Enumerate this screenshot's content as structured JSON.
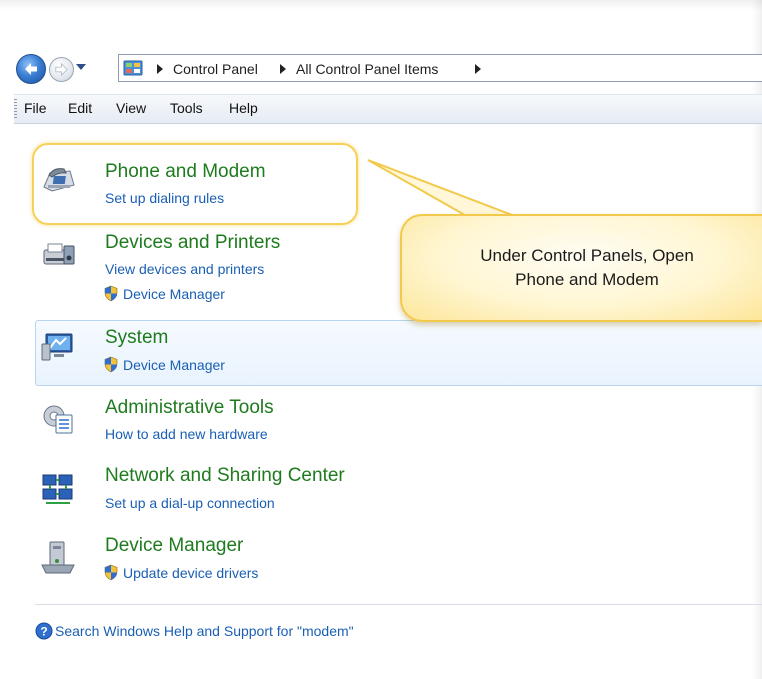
{
  "breadcrumb": {
    "items": [
      "Control Panel",
      "All Control Panel Items"
    ]
  },
  "menu": {
    "items": [
      "File",
      "Edit",
      "View",
      "Tools",
      "Help"
    ]
  },
  "items": [
    {
      "title": "Phone and Modem",
      "links": [
        "Set up dialing rules"
      ]
    },
    {
      "title": "Devices and Printers",
      "links": [
        "View devices and printers"
      ],
      "shield_links": [
        "Device Manager"
      ]
    },
    {
      "title": "System",
      "shield_links": [
        "Device Manager"
      ]
    },
    {
      "title": "Administrative Tools",
      "links": [
        "How to add new hardware"
      ]
    },
    {
      "title": "Network and Sharing Center",
      "links": [
        "Set up a dial-up connection"
      ]
    },
    {
      "title": "Device Manager",
      "shield_links": [
        "Update device drivers"
      ]
    }
  ],
  "callout": {
    "line1": "Under Control Panels, Open",
    "line2": "Phone and Modem"
  },
  "help": {
    "label": "Search Windows Help and Support for \"modem\""
  },
  "colors": {
    "title_green": "#1e7b1e",
    "link_blue": "#1a5fb4",
    "callout_gold": "#f2c94c"
  },
  "icons": [
    "back-arrow-icon",
    "forward-arrow-icon",
    "control-panel-icon",
    "phone-modem-icon",
    "printer-icon",
    "system-monitor-icon",
    "admin-tools-icon",
    "network-icon",
    "device-manager-icon",
    "uac-shield-icon",
    "help-icon"
  ]
}
